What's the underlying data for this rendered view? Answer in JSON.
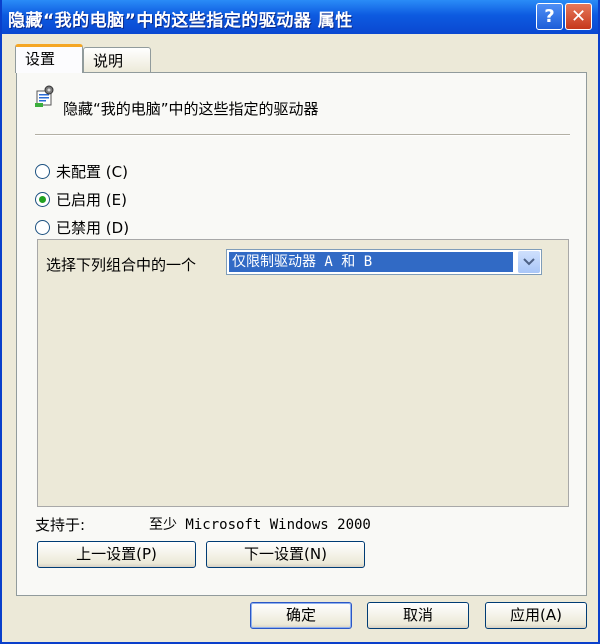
{
  "window": {
    "title": "隐藏“我的电脑”中的这些指定的驱动器 属性",
    "help_symbol": "?",
    "close_symbol": "✕"
  },
  "tabs": [
    {
      "label": "设置",
      "active": true
    },
    {
      "label": "说明",
      "active": false
    }
  ],
  "policy": {
    "title": "隐藏“我的电脑”中的这些指定的驱动器",
    "icon": "policy-settings-icon"
  },
  "radios": [
    {
      "label": "未配置",
      "accel": "(C)",
      "checked": false
    },
    {
      "label": "已启用",
      "accel": "(E)",
      "checked": true
    },
    {
      "label": "已禁用",
      "accel": "(D)",
      "checked": false
    }
  ],
  "options": {
    "select_label": "选择下列组合中的一个",
    "select_value": "仅限制驱动器 A 和 B"
  },
  "supported": {
    "label": "支持于:",
    "value": "至少 Microsoft Windows 2000"
  },
  "nav_buttons": {
    "prev": "上一设置(P)",
    "next": "下一设置(N)"
  },
  "dialog_buttons": {
    "ok": "确定",
    "cancel": "取消",
    "apply": "应用(A)"
  },
  "colors": {
    "titlebar": "#0a48d1",
    "selection": "#316ac5",
    "tab_accent": "#f5a623",
    "radio_checked": "#21a121"
  }
}
